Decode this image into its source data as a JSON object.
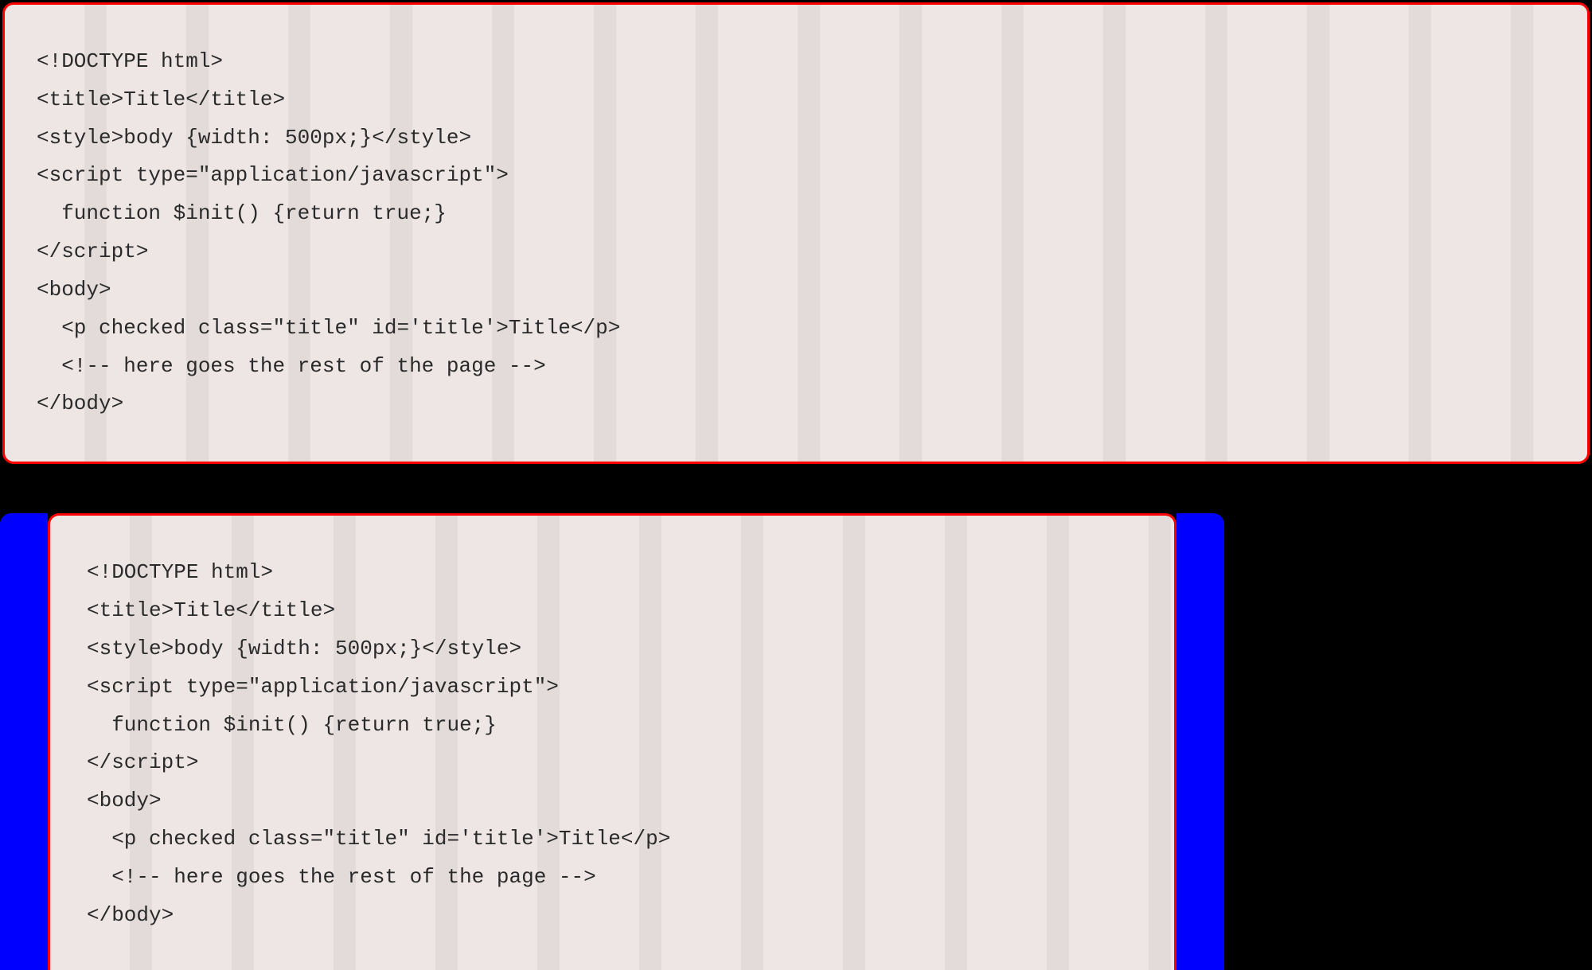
{
  "code_block_1": {
    "lines": [
      "<!DOCTYPE html>",
      "<title>Title</title>",
      "<style>body {width: 500px;}</style>",
      "<script type=\"application/javascript\">",
      "  function $init() {return true;}",
      "</script>",
      "<body>",
      "  <p checked class=\"title\" id='title'>Title</p>",
      "  <!-- here goes the rest of the page -->",
      "</body>"
    ]
  },
  "code_block_2": {
    "lines": [
      "<!DOCTYPE html>",
      "<title>Title</title>",
      "<style>body {width: 500px;}</style>",
      "<script type=\"application/javascript\">",
      "  function $init() {return true;}",
      "</script>",
      "<body>",
      "  <p checked class=\"title\" id='title'>Title</p>",
      "  <!-- here goes the rest of the page -->",
      "</body>"
    ]
  }
}
